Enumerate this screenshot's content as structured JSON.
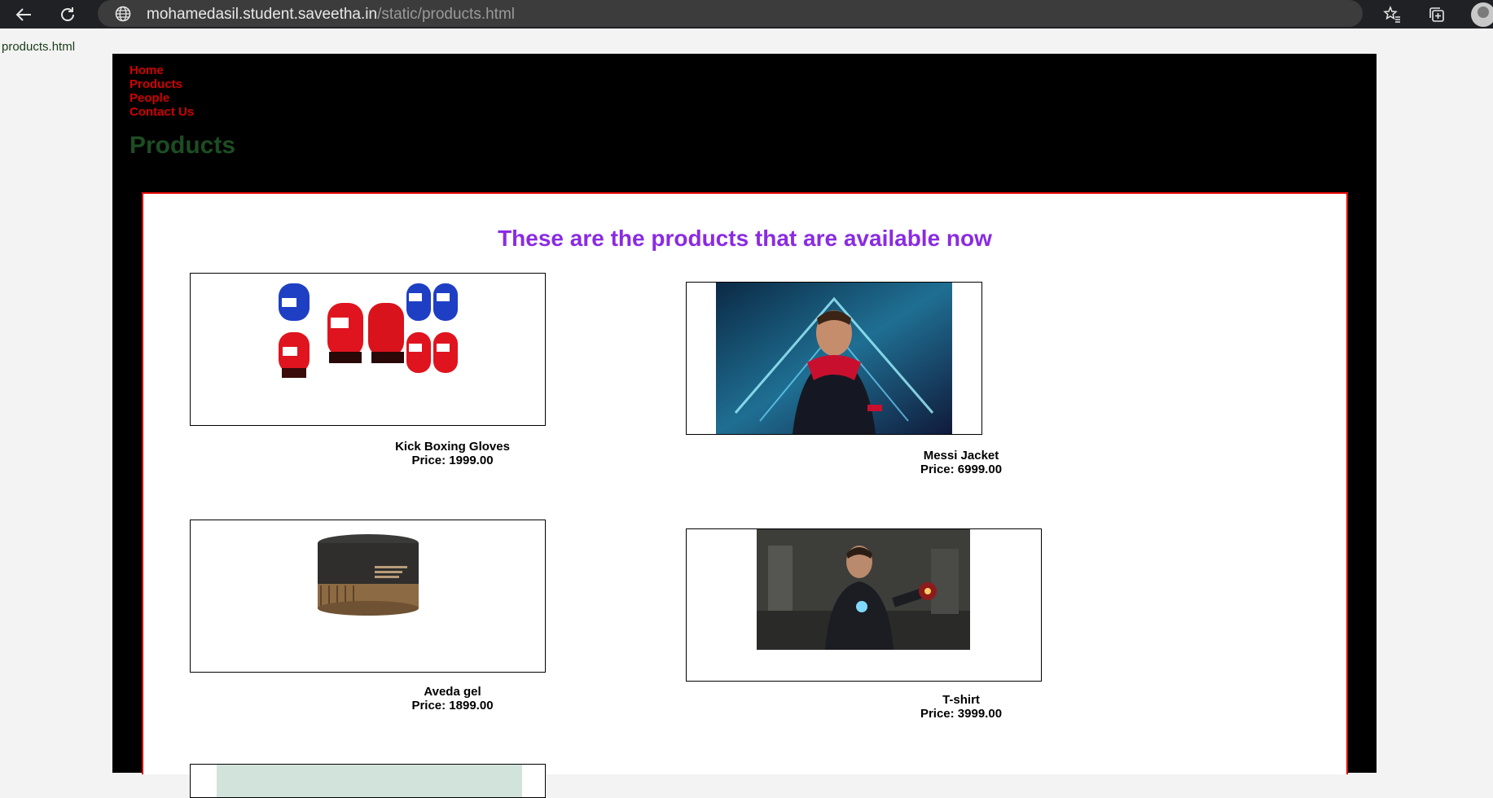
{
  "browser": {
    "url_host": "mohamedasil.student.saveetha.in",
    "url_path": "/static/products.html"
  },
  "breadcrumb": "products.html",
  "nav": {
    "items": [
      {
        "label": "Home"
      },
      {
        "label": "Products"
      },
      {
        "label": "People"
      },
      {
        "label": "Contact Us"
      }
    ]
  },
  "page": {
    "heading": "Products",
    "box_title": "These are the products that are available now"
  },
  "products": [
    {
      "name": "Kick Boxing Gloves",
      "price": "Price: 1999.00"
    },
    {
      "name": "Messi Jacket",
      "price": "Price: 6999.00"
    },
    {
      "name": "Aveda gel",
      "price": "Price: 1899.00"
    },
    {
      "name": "T-shirt",
      "price": "Price: 3999.00"
    }
  ],
  "colors": {
    "nav_link": "#d10000",
    "heading": "#1d4d23",
    "box_border": "#e10000",
    "box_title": "#8a2be2"
  }
}
